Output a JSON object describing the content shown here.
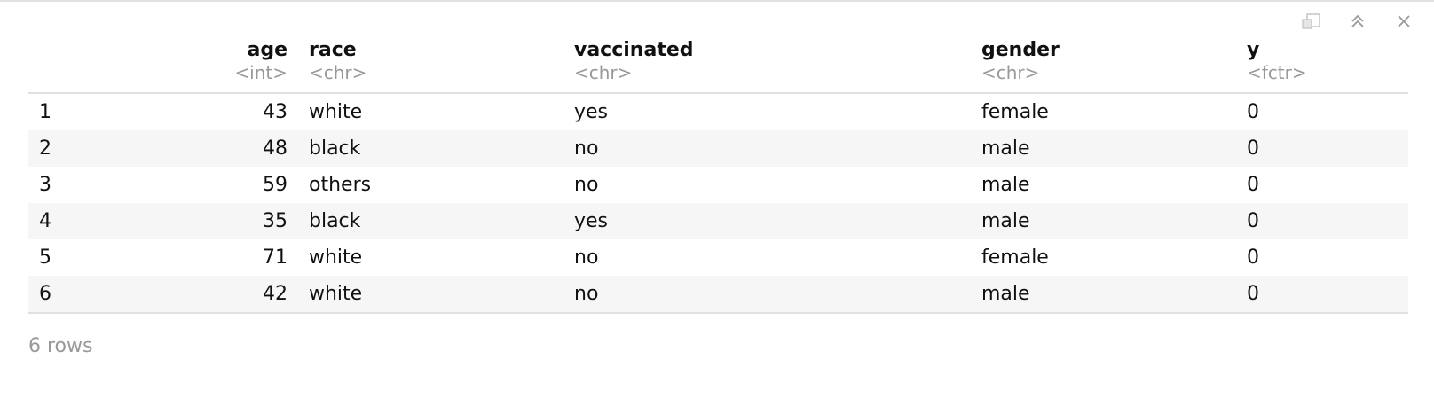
{
  "toolbar": {
    "icons": [
      "export-to-window-icon",
      "collapse-up-icon",
      "close-icon"
    ]
  },
  "table": {
    "columns": [
      {
        "name": "",
        "type": ""
      },
      {
        "name": "age",
        "type": "<int>"
      },
      {
        "name": "race",
        "type": "<chr>"
      },
      {
        "name": "vaccinated",
        "type": "<chr>"
      },
      {
        "name": "gender",
        "type": "<chr>"
      },
      {
        "name": "y",
        "type": "<fctr>"
      }
    ],
    "rows": [
      [
        "1",
        "43",
        "white",
        "yes",
        "female",
        "0"
      ],
      [
        "2",
        "48",
        "black",
        "no",
        "male",
        "0"
      ],
      [
        "3",
        "59",
        "others",
        "no",
        "male",
        "0"
      ],
      [
        "4",
        "35",
        "black",
        "yes",
        "male",
        "0"
      ],
      [
        "5",
        "71",
        "white",
        "no",
        "female",
        "0"
      ],
      [
        "6",
        "42",
        "white",
        "no",
        "male",
        "0"
      ]
    ]
  },
  "footer": {
    "row_count": "6 rows"
  }
}
